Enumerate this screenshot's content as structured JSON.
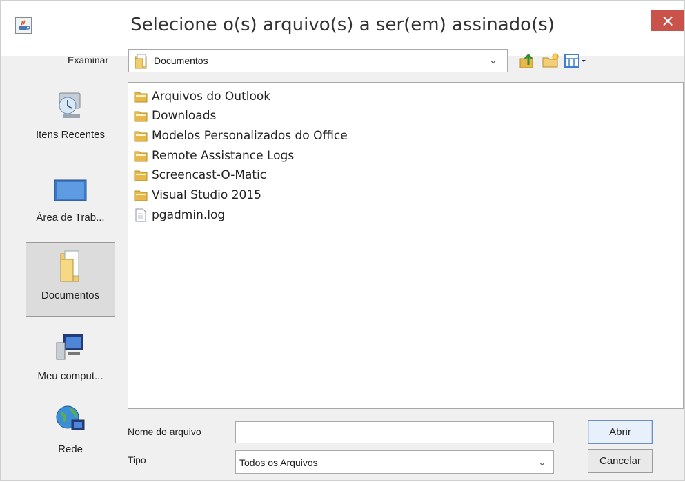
{
  "window": {
    "title": "Selecione o(s) arquivo(s) a ser(em) assinado(s)",
    "close_label": "×",
    "icons": {
      "app": "java-app-icon",
      "close": "close-icon"
    }
  },
  "lookin": {
    "label": "Examinar",
    "value": "Documentos",
    "icon": "documents-folder-icon",
    "toolbar_icons": [
      "up-one-level-icon",
      "new-folder-icon",
      "view-menu-icon"
    ]
  },
  "places": [
    {
      "label": "Itens Recentes",
      "icon": "recent-items-icon",
      "selected": false
    },
    {
      "label": "Área de Trab...",
      "icon": "desktop-icon",
      "selected": false
    },
    {
      "label": "Documentos",
      "icon": "documents-icon",
      "selected": true
    },
    {
      "label": "Meu comput...",
      "icon": "computer-icon",
      "selected": false
    },
    {
      "label": "Rede",
      "icon": "network-icon",
      "selected": false
    }
  ],
  "files": [
    {
      "name": "Arquivos do Outlook",
      "type": "folder"
    },
    {
      "name": "Downloads",
      "type": "folder"
    },
    {
      "name": "Modelos Personalizados do Office",
      "type": "folder"
    },
    {
      "name": "Remote Assistance Logs",
      "type": "folder"
    },
    {
      "name": "Screencast-O-Matic",
      "type": "folder"
    },
    {
      "name": "Visual Studio 2015",
      "type": "folder"
    },
    {
      "name": "pgadmin.log",
      "type": "file"
    }
  ],
  "filename": {
    "label": "Nome do arquivo",
    "value": ""
  },
  "filetype": {
    "label": "Tipo",
    "value": "Todos os Arquivos"
  },
  "buttons": {
    "open": "Abrir",
    "cancel": "Cancelar"
  },
  "colors": {
    "close": "#c9524b",
    "folder": "#e9b84a",
    "selected_place": "#dcdcdc"
  }
}
